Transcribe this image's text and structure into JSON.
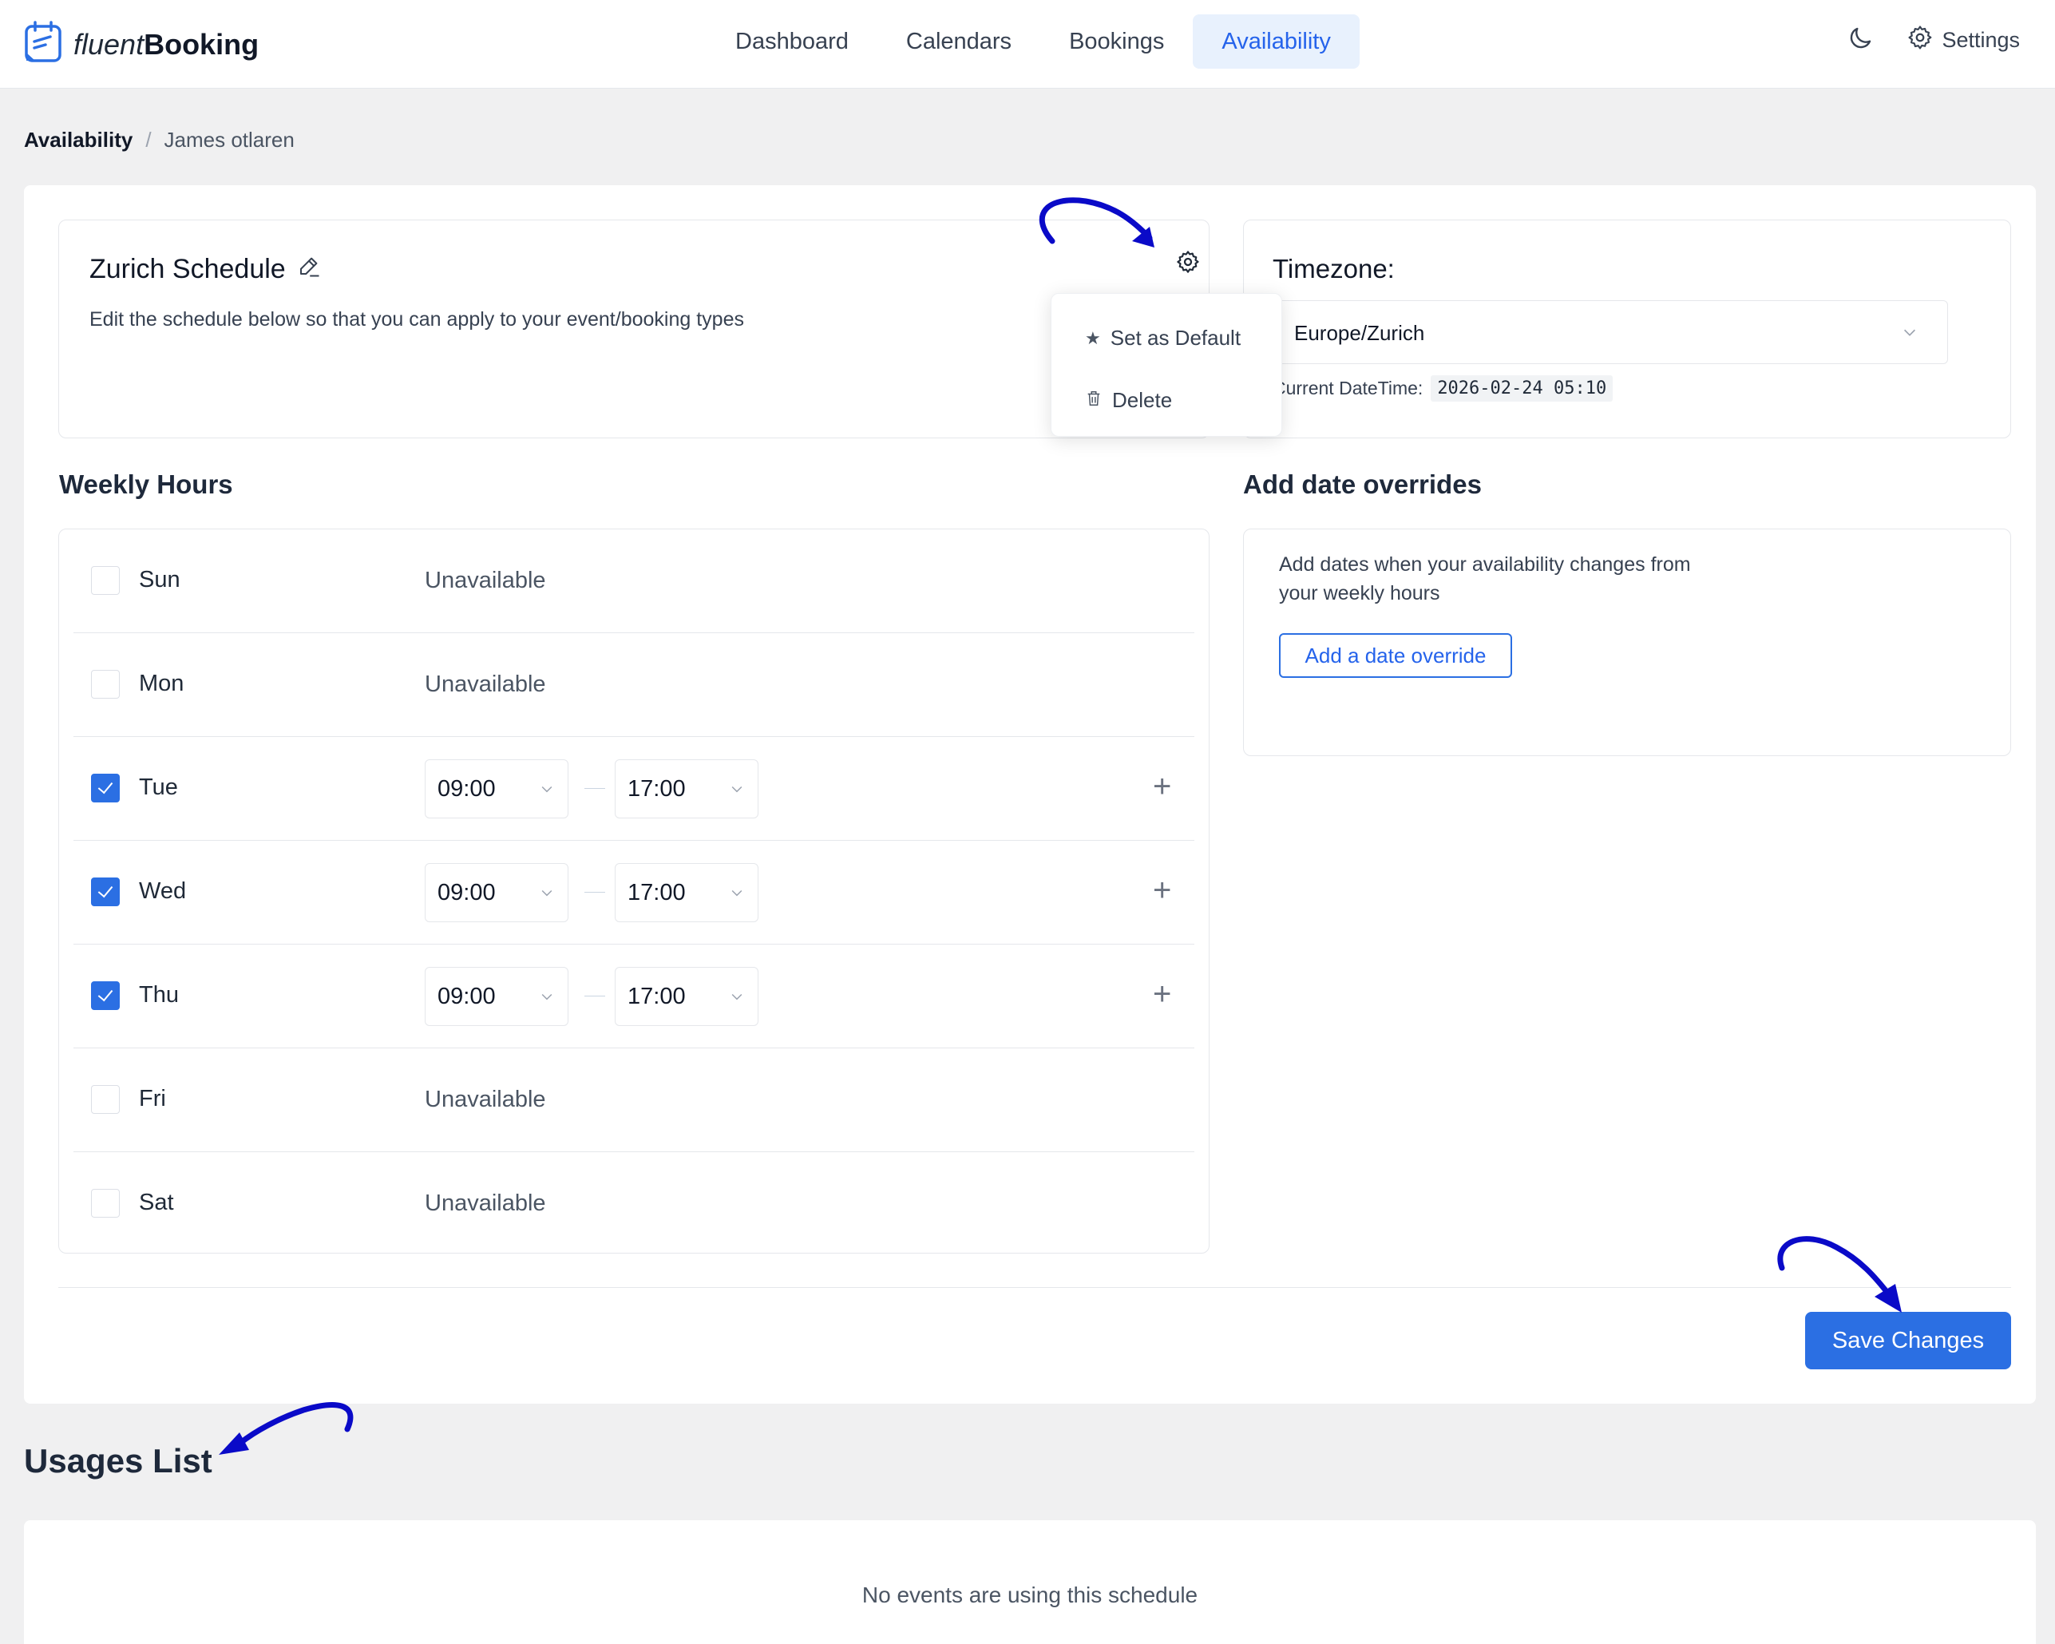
{
  "app": {
    "logo_light": "fluent",
    "logo_bold": "Booking"
  },
  "nav": {
    "items": [
      {
        "label": "Dashboard",
        "active": false
      },
      {
        "label": "Calendars",
        "active": false
      },
      {
        "label": "Bookings",
        "active": false
      },
      {
        "label": "Availability",
        "active": true
      }
    ],
    "settings_label": "Settings"
  },
  "breadcrumb": {
    "root": "Availability",
    "separator": "/",
    "current": "James otlaren"
  },
  "schedule": {
    "title": "Zurich Schedule",
    "description": "Edit the schedule below so that you can apply to your event/booking types"
  },
  "menu": {
    "set_default": "Set as Default",
    "delete": "Delete"
  },
  "timezone": {
    "label": "Timezone:",
    "value": "Europe/Zurich",
    "datetime_label": "Current DateTime:",
    "datetime_value": "2026-02-24 05:10"
  },
  "weekly": {
    "title": "Weekly Hours",
    "unavailable_label": "Unavailable",
    "days": [
      {
        "name": "Sun",
        "checked": false,
        "start": "",
        "end": ""
      },
      {
        "name": "Mon",
        "checked": false,
        "start": "",
        "end": ""
      },
      {
        "name": "Tue",
        "checked": true,
        "start": "09:00",
        "end": "17:00"
      },
      {
        "name": "Wed",
        "checked": true,
        "start": "09:00",
        "end": "17:00"
      },
      {
        "name": "Thu",
        "checked": true,
        "start": "09:00",
        "end": "17:00"
      },
      {
        "name": "Fri",
        "checked": false,
        "start": "",
        "end": ""
      },
      {
        "name": "Sat",
        "checked": false,
        "start": "",
        "end": ""
      }
    ]
  },
  "overrides": {
    "title": "Add date overrides",
    "description": "Add dates when your availability changes from your weekly hours",
    "button": "Add a date override"
  },
  "save_label": "Save Changes",
  "usages": {
    "title": "Usages List",
    "empty": "No events are using this schedule"
  },
  "colors": {
    "primary": "#2b6fe3",
    "annotation_arrow": "#0a0ac8",
    "nav_active_bg": "#e8f1fd"
  }
}
